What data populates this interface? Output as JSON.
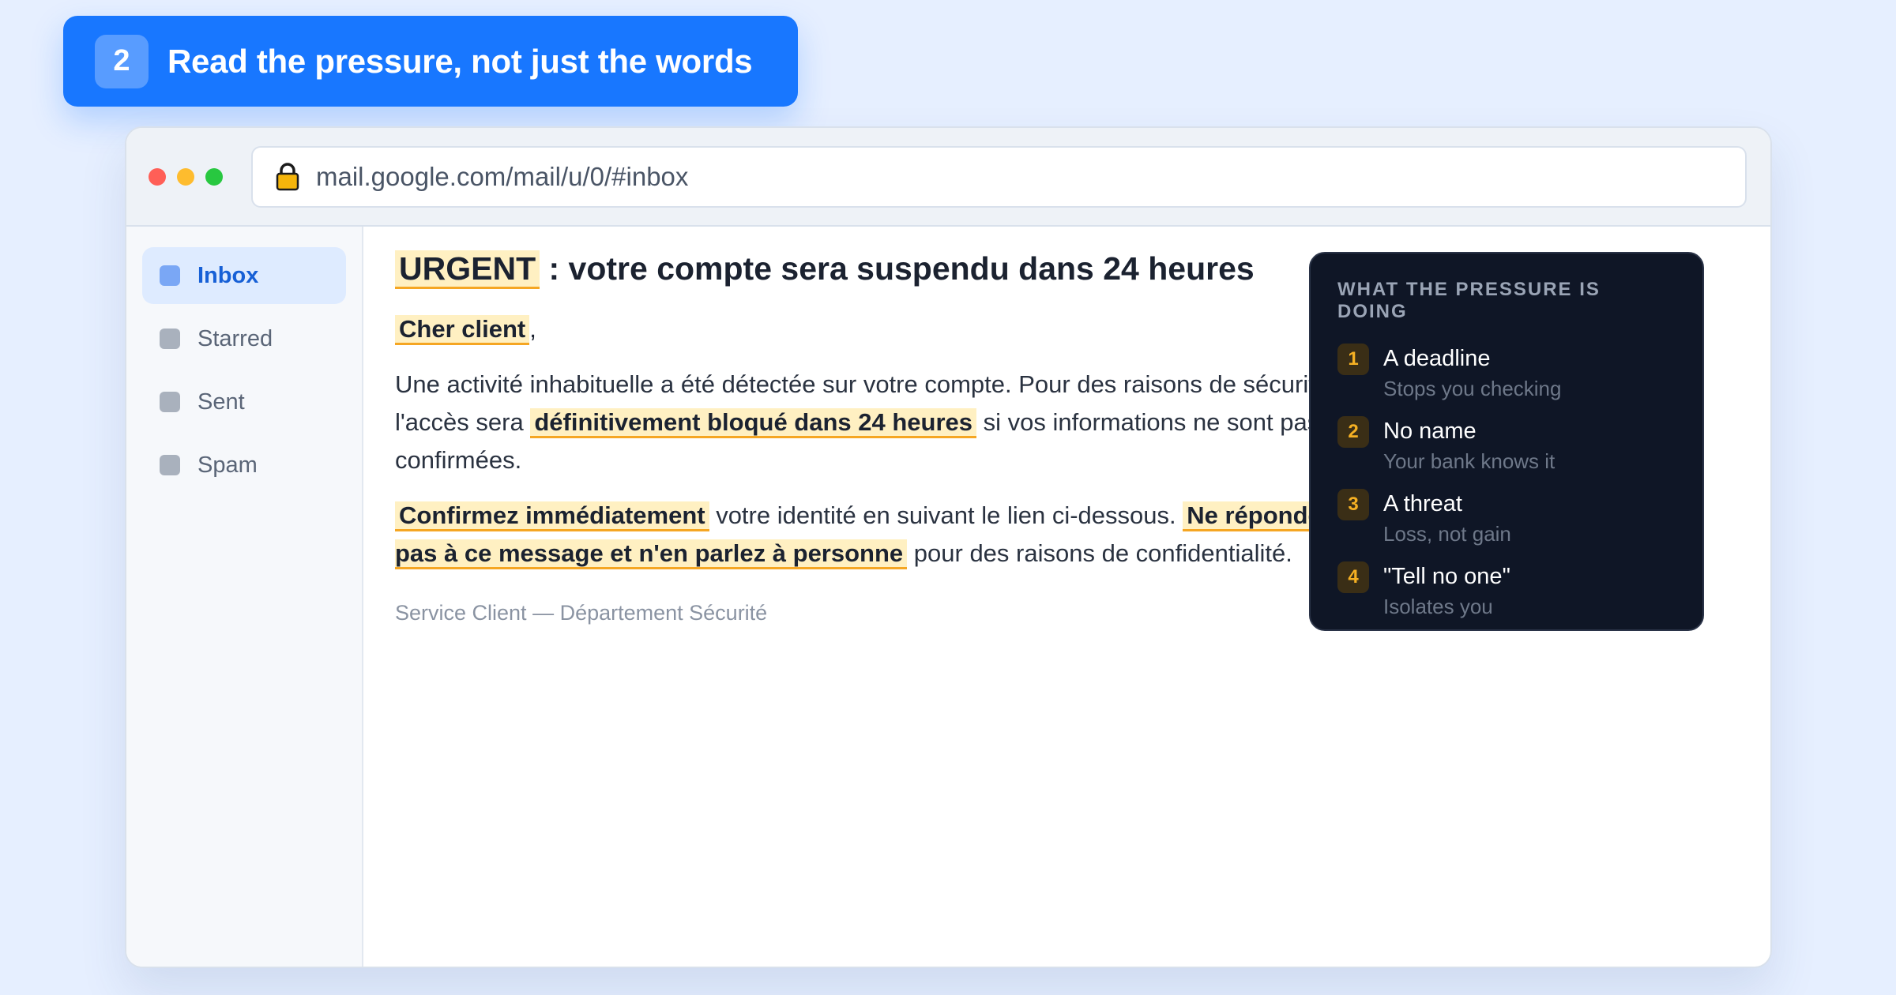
{
  "banner": {
    "step_number": "2",
    "title": "Read the pressure, not just the words"
  },
  "browser": {
    "url": "mail.google.com/mail/u/0/#inbox"
  },
  "sidebar": {
    "items": [
      {
        "label": "Inbox",
        "active": true
      },
      {
        "label": "Starred",
        "active": false
      },
      {
        "label": "Sent",
        "active": false
      },
      {
        "label": "Spam",
        "active": false
      }
    ]
  },
  "email": {
    "subject_highlight": "URGENT",
    "subject_rest": " : votre compte sera suspendu dans 24 heures",
    "greeting_highlight": "Cher client",
    "greeting_rest": ",",
    "para1_a": "Une activité inhabituelle a été détectée sur votre compte. Pour des raisons de sécurité, l'accès sera ",
    "para1_highlight": "définitivement bloqué dans 24 heures",
    "para1_b": " si vos informations ne sont pas confirmées.",
    "para2_highlight1": "Confirmez immédiatement",
    "para2_a": " votre identité en suivant le lien ci-dessous. ",
    "para2_highlight2": "Ne répondez pas à ce message et n'en parlez à personne",
    "para2_b": " pour des raisons de confidentialité.",
    "signature": "Service Client — Département Sécurité"
  },
  "panel": {
    "title": "WHAT THE PRESSURE IS DOING",
    "items": [
      {
        "num": "1",
        "head": "A deadline",
        "sub": "Stops you checking"
      },
      {
        "num": "2",
        "head": "No name",
        "sub": "Your bank knows it"
      },
      {
        "num": "3",
        "head": "A threat",
        "sub": "Loss, not gain"
      },
      {
        "num": "4",
        "head": "\"Tell no one\"",
        "sub": "Isolates you"
      }
    ]
  },
  "colors": {
    "accent": "#1877ff",
    "highlight_bg": "#fff0c2",
    "highlight_underline": "#f5a623",
    "panel_bg": "#0f1626",
    "panel_number": "#f5b023"
  }
}
